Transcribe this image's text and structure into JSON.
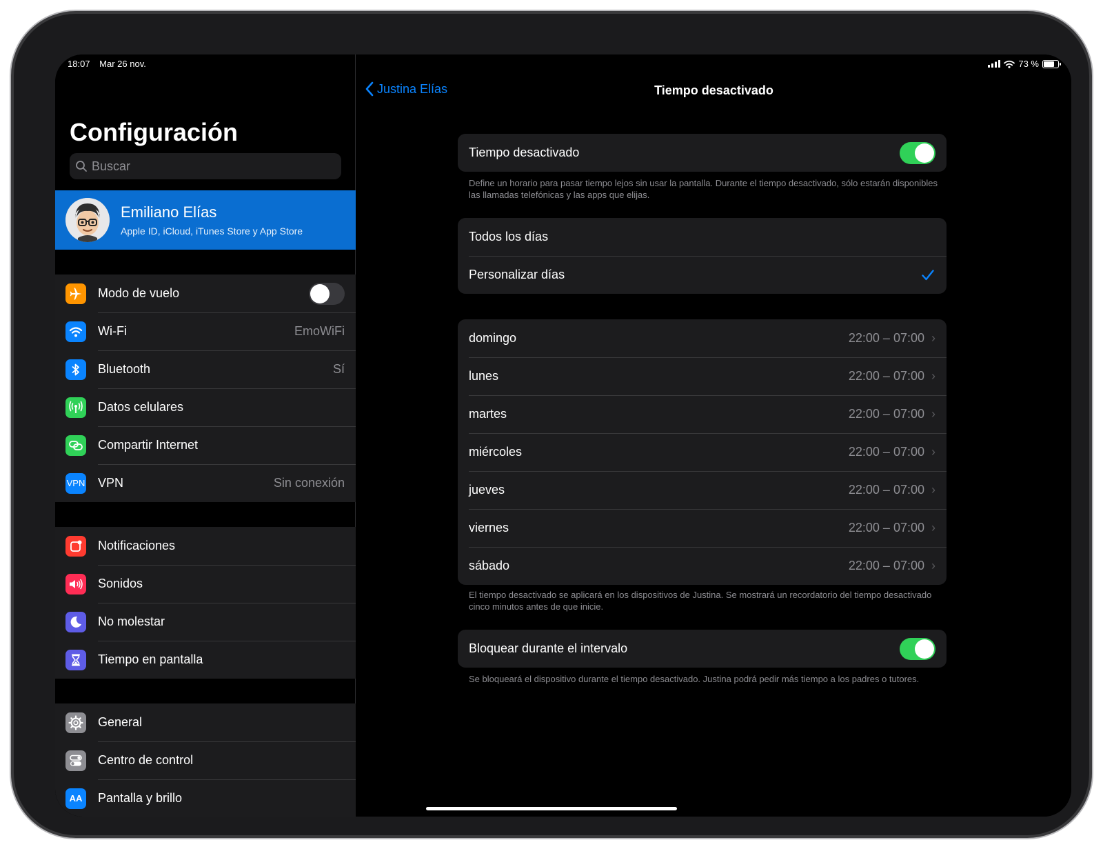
{
  "status": {
    "time": "18:07",
    "date": "Mar 26 nov.",
    "battery": "73 %",
    "battery_level": 0.73
  },
  "sidebar": {
    "title": "Configuración",
    "search_placeholder": "Buscar",
    "profile": {
      "name": "Emiliano Elías",
      "subtitle": "Apple ID, iCloud, iTunes Store y App Store"
    },
    "group1": [
      {
        "label": "Modo de vuelo",
        "icon": "airplane-icon",
        "color": "#ff9500",
        "toggle": false
      },
      {
        "label": "Wi-Fi",
        "icon": "wifi-icon",
        "color": "#0a84ff",
        "value": "EmoWiFi"
      },
      {
        "label": "Bluetooth",
        "icon": "bluetooth-icon",
        "color": "#0a84ff",
        "value": "Sí"
      },
      {
        "label": "Datos celulares",
        "icon": "antenna-icon",
        "color": "#30d158"
      },
      {
        "label": "Compartir Internet",
        "icon": "hotspot-icon",
        "color": "#30d158"
      },
      {
        "label": "VPN",
        "icon": "vpn-icon",
        "icon_text": "VPN",
        "color": "#0a84ff",
        "value": "Sin conexión"
      }
    ],
    "group2": [
      {
        "label": "Notificaciones",
        "icon": "notifications-icon",
        "color": "#ff3b30"
      },
      {
        "label": "Sonidos",
        "icon": "speaker-icon",
        "color": "#ff2d55"
      },
      {
        "label": "No molestar",
        "icon": "moon-icon",
        "color": "#5e5ce6"
      },
      {
        "label": "Tiempo en pantalla",
        "icon": "hourglass-icon",
        "color": "#5e5ce6"
      }
    ],
    "group3": [
      {
        "label": "General",
        "icon": "gear-icon",
        "color": "#8e8e93"
      },
      {
        "label": "Centro de control",
        "icon": "switches-icon",
        "color": "#8e8e93"
      },
      {
        "label": "Pantalla y brillo",
        "icon": "display-icon",
        "color": "#0a84ff"
      }
    ]
  },
  "detail": {
    "back_label": "Justina Elías",
    "title": "Tiempo desactivado",
    "downtime": {
      "label": "Tiempo desactivado",
      "on": true,
      "footer": "Define un horario para pasar tiempo lejos sin usar la pantalla. Durante el tiempo desactivado, sólo estarán disponibles las llamadas telefónicas y las apps que elijas."
    },
    "schedule": [
      {
        "label": "Todos los días",
        "checked": false
      },
      {
        "label": "Personalizar días",
        "checked": true
      }
    ],
    "days": [
      {
        "label": "domingo",
        "value": "22:00 – 07:00"
      },
      {
        "label": "lunes",
        "value": "22:00 – 07:00"
      },
      {
        "label": "martes",
        "value": "22:00 – 07:00"
      },
      {
        "label": "miércoles",
        "value": "22:00 – 07:00"
      },
      {
        "label": "jueves",
        "value": "22:00 – 07:00"
      },
      {
        "label": "viernes",
        "value": "22:00 – 07:00"
      },
      {
        "label": "sábado",
        "value": "22:00 – 07:00"
      }
    ],
    "days_footer": "El tiempo desactivado se aplicará en los dispositivos de Justina. Se mostrará un recordatorio del tiempo desactivado cinco minutos antes de que inicie.",
    "block": {
      "label": "Bloquear durante el intervalo",
      "on": true,
      "footer": "Se bloqueará el dispositivo durante el tiempo desactivado. Justina podrá pedir más tiempo a los padres o tutores."
    }
  }
}
